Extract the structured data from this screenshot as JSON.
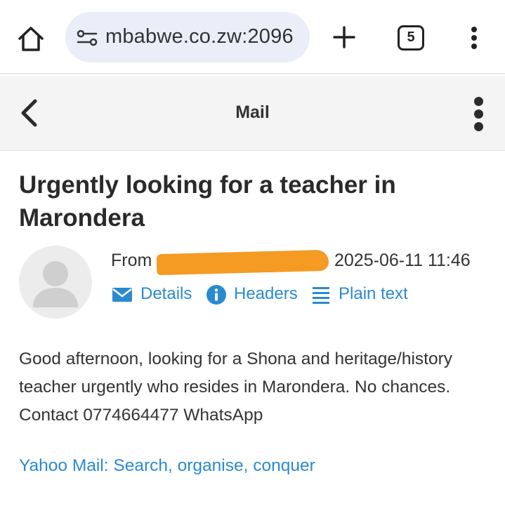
{
  "browser": {
    "url_partial": "mbabwe.co.zw:2096",
    "url_leading": "",
    "tab_count": "5",
    "icons": [
      "home-icon",
      "site-info-icon",
      "plus-icon",
      "tab-switcher-icon",
      "more-vert-icon"
    ]
  },
  "app": {
    "title": "Mail",
    "icons": [
      "back-chevron-icon",
      "kebab-menu-icon"
    ]
  },
  "message": {
    "subject": "Urgently looking for a teacher in Marondera",
    "from_label": "From",
    "date": "2025-06-11 11:46",
    "actions": {
      "details": "Details",
      "headers": "Headers",
      "plain_text": "Plain text"
    },
    "body": "Good afternoon, looking for a Shona and heritage/history teacher urgently who resides in Marondera. No chances. Contact 0774664477 WhatsApp",
    "footer_link": "Yahoo Mail: Search, organise, conquer"
  },
  "colors": {
    "link": "#2a8ad0",
    "redaction": "#f59a23",
    "url_pill": "#e9eef8",
    "header_bg": "#f4f4f4"
  }
}
